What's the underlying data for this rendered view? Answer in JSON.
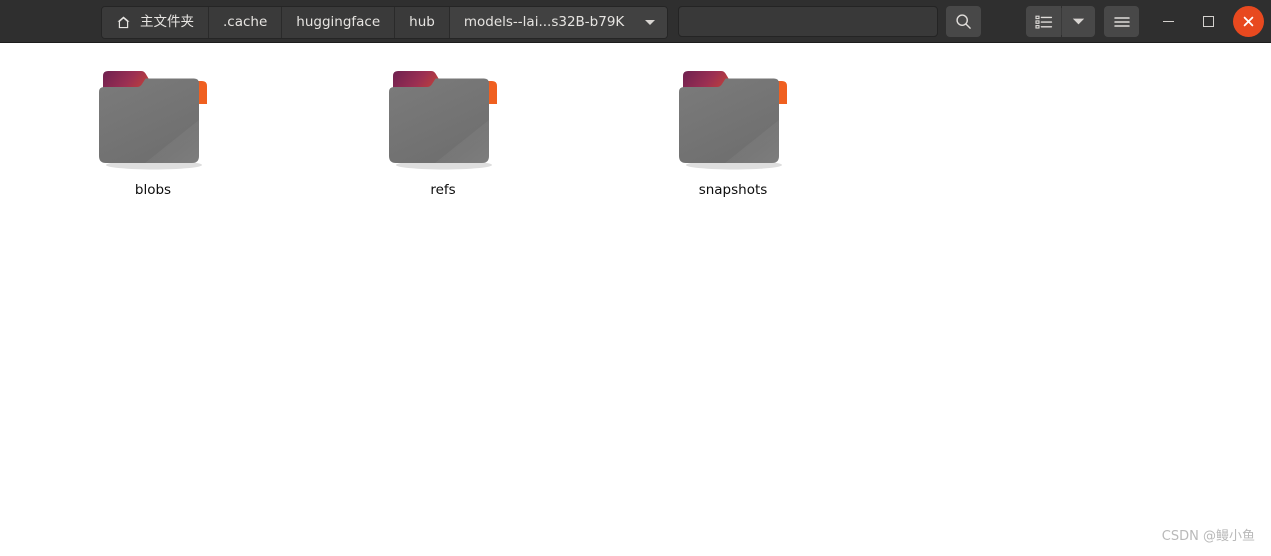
{
  "window": {
    "title": "models--lai...s32B-b79K",
    "accent_color": "#e8491f",
    "headerbar_color": "#2f2f2f",
    "content_background": "#ffffff"
  },
  "pathbar": {
    "crumbs": [
      {
        "label": "主文件夹",
        "icon": "home-icon",
        "current": false
      },
      {
        "label": ".cache",
        "icon": "",
        "current": false
      },
      {
        "label": "huggingface",
        "icon": "",
        "current": false
      },
      {
        "label": "hub",
        "icon": "",
        "current": false
      },
      {
        "label": "models--lai...s32B-b79K",
        "icon": "",
        "current": true
      }
    ]
  },
  "location_entry": {
    "value": "",
    "placeholder": ""
  },
  "toolbar": {
    "search_icon": "search-icon",
    "view_list_icon": "list-view-icon",
    "view_menu_icon": "chevron-down-icon",
    "hamburger_icon": "hamburger-menu-icon"
  },
  "window_controls": {
    "minimize_icon": "minimize-icon",
    "maximize_icon": "maximize-icon",
    "close_icon": "close-icon"
  },
  "files": {
    "items": [
      {
        "name": "blobs",
        "type": "folder"
      },
      {
        "name": "refs",
        "type": "folder"
      },
      {
        "name": "snapshots",
        "type": "folder"
      }
    ]
  },
  "watermark": {
    "text": "CSDN @鳗小鱼"
  }
}
